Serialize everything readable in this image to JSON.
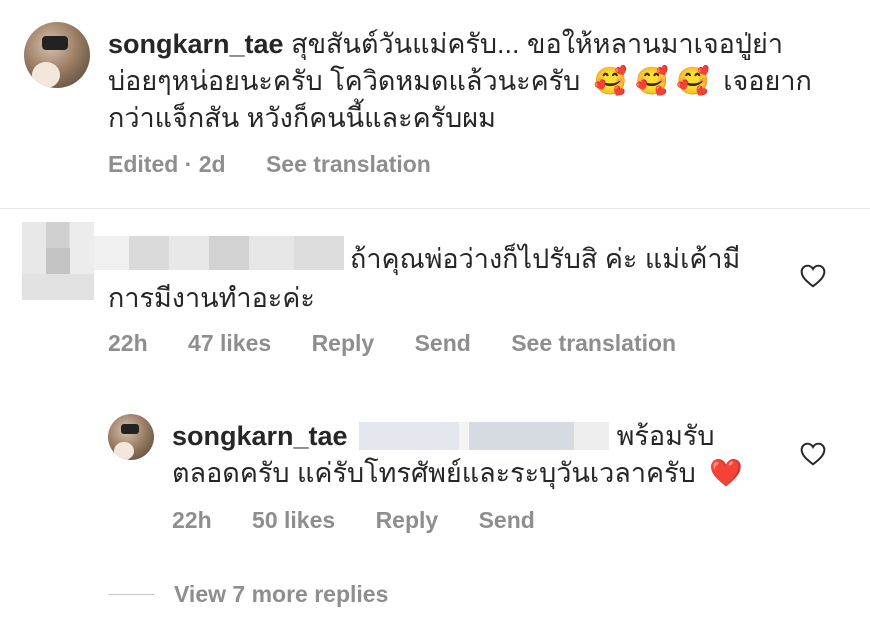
{
  "comments": [
    {
      "username": "songkarn_tae",
      "text": "สุขสันต์วันแม่ครับ... ขอให้หลานมาเจอปู่ย่า",
      "text_line2": "บ่อยๆหน่อยนะครับ โควิดหมดแล้วนะครับ",
      "emoji": [
        "🥰",
        "🥰",
        "🥰"
      ],
      "text_line2_tail": "เจอยาก",
      "text_line3": "กว่าแจ็กสัน หวังก็คนนี้และครับผม",
      "meta": {
        "edited": "Edited · 2d",
        "translate": "See translation"
      }
    },
    {
      "text": "ถ้าคุณพ่อว่างก็ไปรับสิ ค่ะ แม่เค้ามี",
      "text_line2": "การมีงานทำอะค่ะ",
      "meta": {
        "time": "22h",
        "likes": "47 likes",
        "reply": "Reply",
        "send": "Send",
        "translate": "See translation"
      }
    },
    {
      "username": "songkarn_tae",
      "text_tail": "พร้อมรับ",
      "text_line2": "ตลอดครับ แค่รับโทรศัพย์และระบุวันเวลาครับ",
      "emoji": "❤️",
      "meta": {
        "time": "22h",
        "likes": "50 likes",
        "reply": "Reply",
        "send": "Send"
      }
    }
  ],
  "view_more": "View 7 more replies",
  "colors": {
    "text": "#262626",
    "meta": "#8e8e8e",
    "divider": "#e6e6e6",
    "heart": "#e0245e"
  }
}
